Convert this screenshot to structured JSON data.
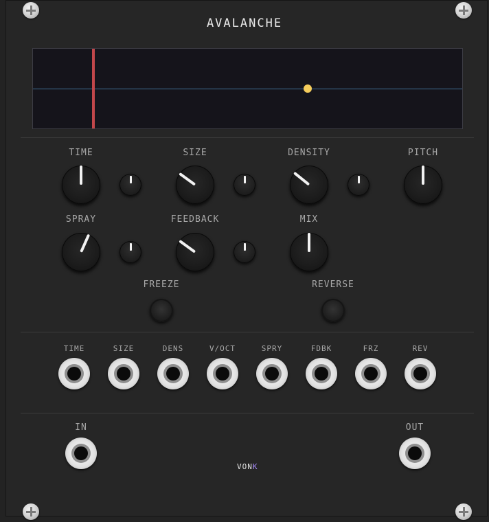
{
  "module": {
    "title": "AVALANCHE"
  },
  "display": {
    "playhead_position": 0.14,
    "marker_position": 0.64,
    "marker_level": 0.5
  },
  "knobs": [
    {
      "id": "time",
      "label": "TIME",
      "value": 0.5,
      "has_attenuator": true
    },
    {
      "id": "size",
      "label": "SIZE",
      "value": 0.32,
      "has_attenuator": true
    },
    {
      "id": "density",
      "label": "DENSITY",
      "value": 0.33,
      "has_attenuator": true
    },
    {
      "id": "pitch",
      "label": "PITCH",
      "value": 0.5,
      "has_attenuator": false
    },
    {
      "id": "spray",
      "label": "SPRAY",
      "value": 0.58,
      "has_attenuator": true
    },
    {
      "id": "feedback",
      "label": "FEEDBACK",
      "value": 0.32,
      "has_attenuator": true
    },
    {
      "id": "mix",
      "label": "MIX",
      "value": 0.5,
      "has_attenuator": false
    }
  ],
  "buttons": [
    {
      "id": "freeze",
      "label": "FREEZE"
    },
    {
      "id": "reverse",
      "label": "REVERSE"
    }
  ],
  "cv_inputs": [
    {
      "id": "time",
      "label": "TIME"
    },
    {
      "id": "size",
      "label": "SIZE"
    },
    {
      "id": "dens",
      "label": "DENS"
    },
    {
      "id": "voct",
      "label": "V/OCT"
    },
    {
      "id": "spry",
      "label": "SPRY"
    },
    {
      "id": "fdbk",
      "label": "FDBK"
    },
    {
      "id": "frz",
      "label": "FRZ"
    },
    {
      "id": "rev",
      "label": "REV"
    }
  ],
  "audio": {
    "in_label": "IN",
    "out_label": "OUT"
  },
  "brand": {
    "name_main": "VON",
    "name_accent": "K",
    "accent_color": "#a78bfa"
  },
  "colors": {
    "playhead": "#c2474b",
    "marker": "#f5cd5c",
    "center_line": "#3f6f95"
  },
  "icons": {
    "screw": "screw-icon"
  }
}
